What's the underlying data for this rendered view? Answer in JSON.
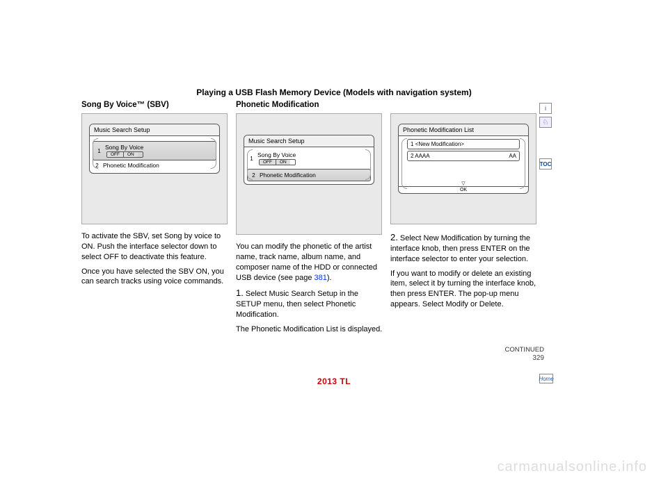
{
  "section_title": "Playing a USB Flash Memory Device (Models with navigation system)",
  "sidebar": {
    "info_icon": "i",
    "car_icon": "♘",
    "toc_label": "TOC",
    "home_label": "Home"
  },
  "col1": {
    "heading": "Song By Voice™ (SBV)",
    "screen": {
      "title": "Music Search Setup",
      "row1_num": "1",
      "row1_label": "Song By Voice",
      "toggle_off": "OFF",
      "toggle_on": "ON",
      "row2_num": "2",
      "row2_label": "Phonetic Modification"
    },
    "para1a": "To activate the SBV, set Song by voice to ON. Push the interface selector down to select OFF to deactivate this feature.",
    "para1b": "Once you have selected the SBV ON, you can search tracks using voice commands."
  },
  "col2": {
    "heading": "Phonetic Modification",
    "screen": {
      "title": "Music Search Setup",
      "row1_num": "1",
      "row1_label": "Song By Voice",
      "toggle_off": "OFF",
      "toggle_on": "ON",
      "row2_num": "2",
      "row2_label": "Phonetic Modification"
    },
    "para2a": "You can modify the phonetic of the artist name, track name, album name, and composer name of the HDD or connected USB device (see page ",
    "para2a_link": "381",
    "para2a_tail": ").",
    "step1_num": "1.",
    "step1_text": "Select Music Search Setup in the SETUP menu, then select Phonetic Modification.",
    "para2b": "The Phonetic Modification List is displayed."
  },
  "col3": {
    "screen": {
      "title": "Phonetic Modification List",
      "row1_num": "1",
      "row1_label": "<New Modification>",
      "row2_num": "2",
      "row2_label": "AAAA",
      "row2_right": "AA",
      "ok": "OK"
    },
    "step2_num": "2.",
    "step2_text": "Select New Modification by turning the interface knob, then press ENTER on the interface selector to enter your selection.",
    "para3a": "If you want to modify or delete an existing item, select it by turning the interface knob, then press ENTER. The pop-up menu appears. Select Modify or Delete.",
    "continued": "CONTINUED",
    "page_num": "329"
  },
  "footer": {
    "model": "2013 TL"
  },
  "watermark": "carmanualsonline.info"
}
